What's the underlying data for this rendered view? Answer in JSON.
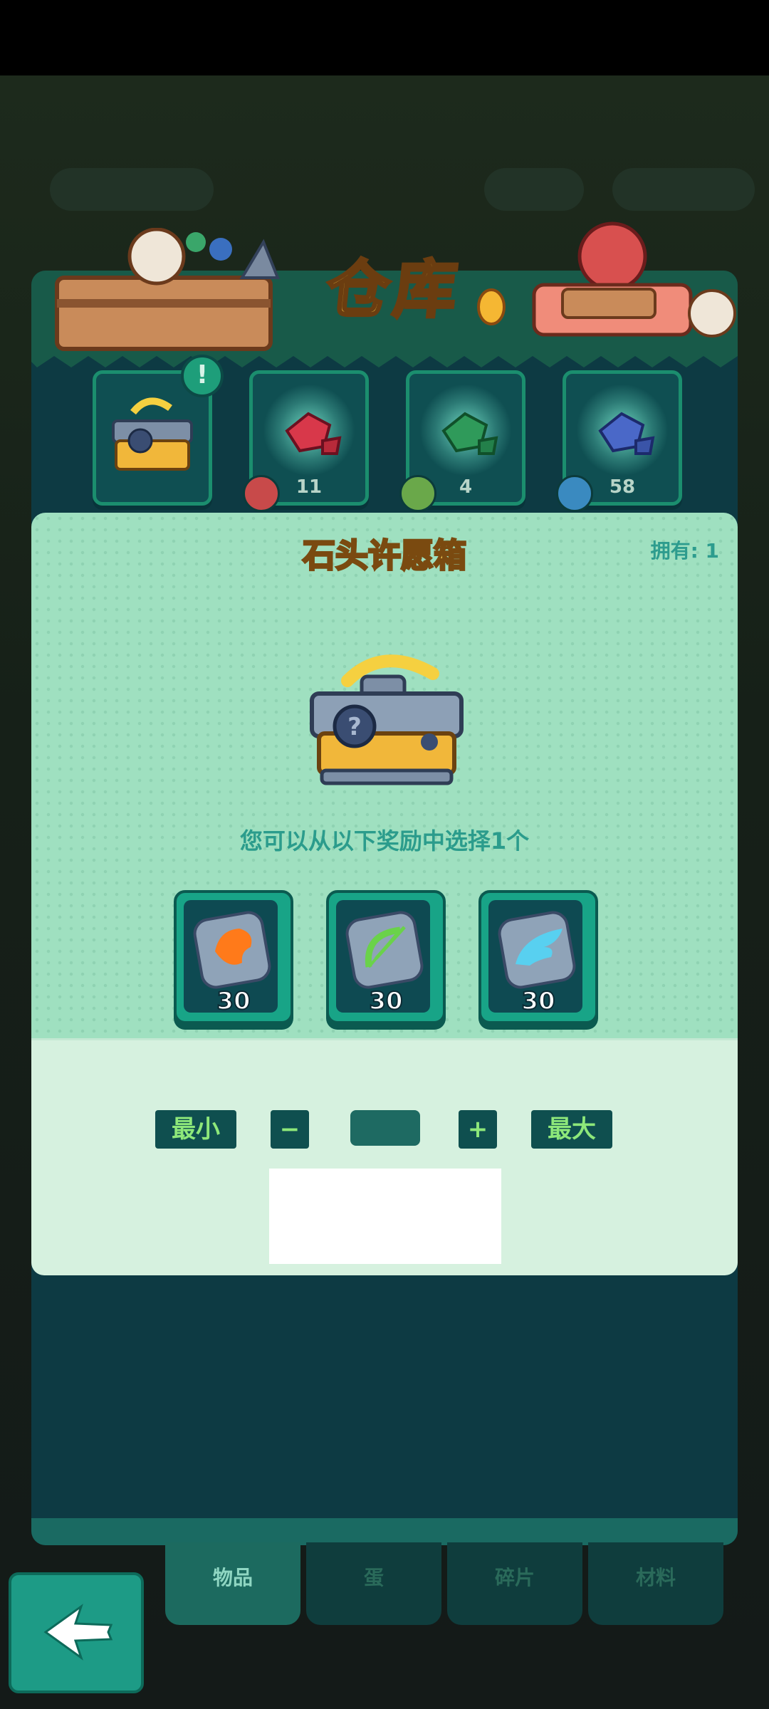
{
  "header": {
    "title": "仓库"
  },
  "item_slots": [
    {
      "name": "stone-chest",
      "count": ""
    },
    {
      "name": "red-stone",
      "count": "11"
    },
    {
      "name": "green-stone",
      "count": "4"
    },
    {
      "name": "blue-stone",
      "count": "58"
    }
  ],
  "detail": {
    "title": "石头许愿箱",
    "owned": "拥有: 1",
    "choose_text": "您可以从以下奖励中选择1个",
    "rewards": [
      {
        "name": "orange-stone",
        "qty": "30"
      },
      {
        "name": "green-bow-stone",
        "qty": "30"
      },
      {
        "name": "blue-wing-stone",
        "qty": "30"
      }
    ]
  },
  "quantity": {
    "min_label": "最小",
    "minus_label": "−",
    "plus_label": "+",
    "max_label": "最大",
    "value": ""
  },
  "tabs": [
    {
      "label": "物品",
      "active": true
    },
    {
      "label": "蛋",
      "active": false
    },
    {
      "label": "碎片",
      "active": false
    },
    {
      "label": "材料",
      "active": false
    }
  ],
  "colors": {
    "panel": "#0d3a43",
    "accent": "#1d9b86",
    "title_gold": "#ffd14a",
    "content_mint": "#9fe0c0"
  }
}
